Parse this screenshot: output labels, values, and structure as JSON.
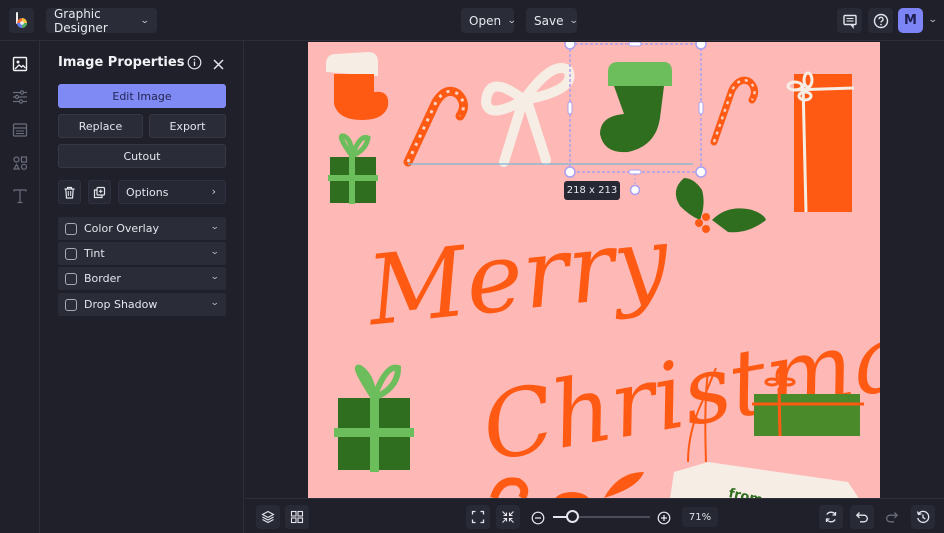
{
  "app": {
    "mode_label": "Graphic Designer",
    "open_label": "Open",
    "save_label": "Save",
    "avatar_initial": "M",
    "accent_color": "#7f8af5"
  },
  "rail": {
    "items": [
      "image-icon",
      "sliders-icon",
      "layout-icon",
      "shapes-icon",
      "text-icon"
    ]
  },
  "panel": {
    "title": "Image Properties",
    "edit_image_label": "Edit Image",
    "replace_label": "Replace",
    "export_label": "Export",
    "cutout_label": "Cutout",
    "options_label": "Options",
    "effects": [
      {
        "label": "Color Overlay",
        "checked": false
      },
      {
        "label": "Tint",
        "checked": false
      },
      {
        "label": "Border",
        "checked": false
      },
      {
        "label": "Drop Shadow",
        "checked": false
      }
    ]
  },
  "canvas": {
    "headline_line1": "Merry",
    "headline_line2": "Christmas",
    "tag_text": "from",
    "background_color": "#feb8b5",
    "selection_size": "218 x 213"
  },
  "bottombar": {
    "zoom_level": "71%",
    "zoom_fraction": 0.2
  }
}
